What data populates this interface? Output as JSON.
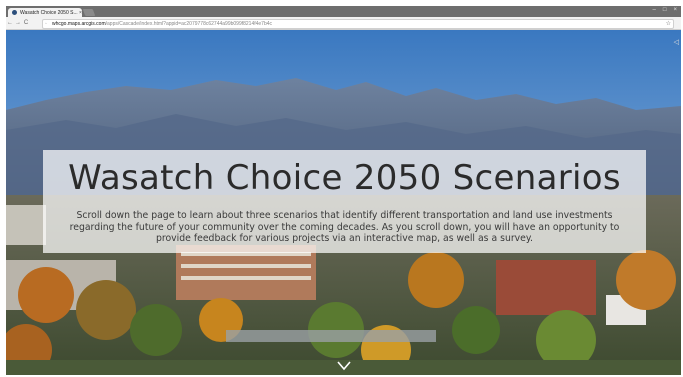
{
  "browser": {
    "tab_title": "Wasatch Choice 2050 S...",
    "tab_close": "×",
    "window_controls": [
      "–",
      "□",
      "×"
    ],
    "nav": {
      "back": "←",
      "forward": "→",
      "reload": "C"
    },
    "url_host": "whcgo.maps.arcgis.com",
    "url_path": "/apps/Cascade/index.html?appid=ac2079778c62744a99b099f8214f4e7b4c",
    "star": "☆"
  },
  "hero": {
    "title": "Wasatch Choice 2050 Scenarios",
    "description": "Scroll down the page to learn about three scenarios that identify different transportation and land use investments regarding the future of your community over the coming decades. As you scroll down, you will have an opportunity to provide feedback for various projects via an interactive map, as well as a survey."
  },
  "colors": {
    "sky_top": "#3f7ec4",
    "sky_bottom": "#a8c8e6",
    "mountain": "#5a6f8c",
    "foliage": "#c07a2a"
  },
  "icons": {
    "scroll": "chevron-down-icon",
    "favicon": "arcgis-icon"
  }
}
